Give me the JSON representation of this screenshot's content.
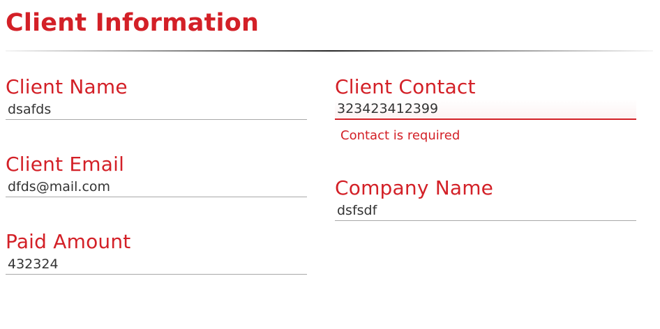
{
  "form": {
    "title": "Client Information",
    "fields": {
      "client_name": {
        "label": "Client Name",
        "value": "dsafds"
      },
      "client_email": {
        "label": "Client Email",
        "value": "dfds@mail.com"
      },
      "paid_amount": {
        "label": "Paid Amount",
        "value": "432324"
      },
      "client_contact": {
        "label": "Client Contact",
        "value": "323423412399",
        "error": "Contact is required"
      },
      "company_name": {
        "label": "Company Name",
        "value": "dsfsdf"
      }
    }
  },
  "colors": {
    "accent": "#d32027",
    "text": "#333333",
    "underline": "#a8a8a8"
  }
}
